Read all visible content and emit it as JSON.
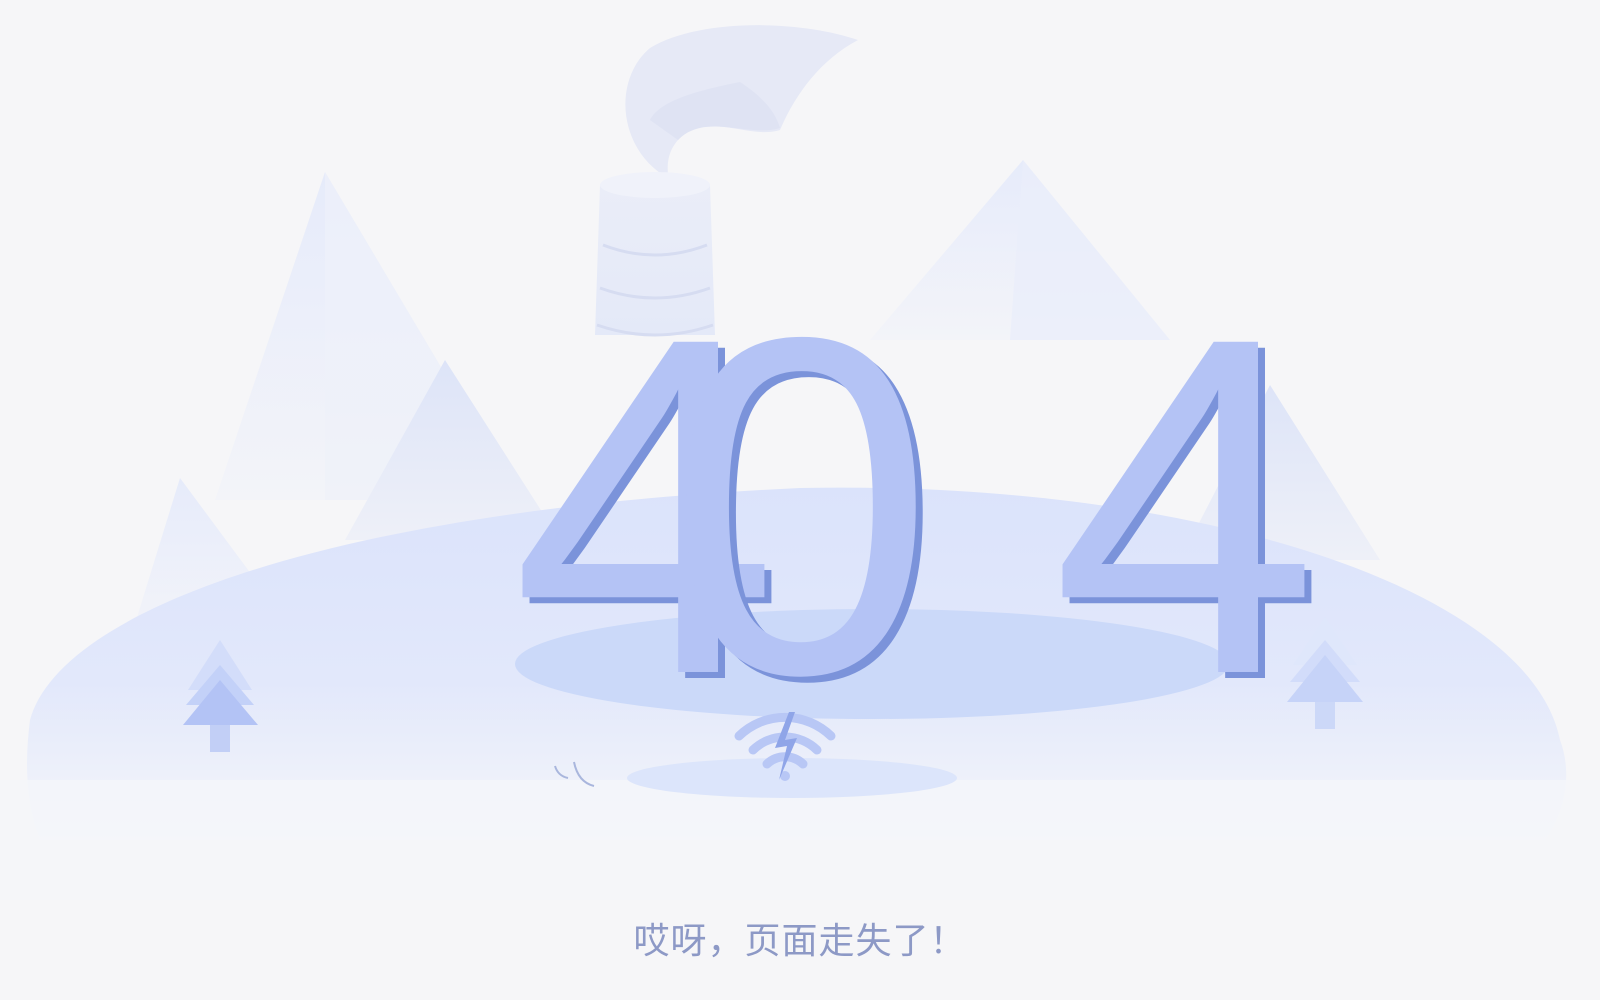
{
  "error": {
    "code": "404",
    "message": "哎呀，页面走失了！"
  },
  "illustration": {
    "elements": [
      "factory-chimney",
      "smoke",
      "mountains",
      "hill",
      "pine-trees",
      "broken-wifi-icon",
      "grass-tufts"
    ]
  },
  "colors": {
    "background": "#f6f6f8",
    "digit_face": "#b4c3f5",
    "digit_side": "#7b93da",
    "message_text": "#8d99c6",
    "hill": "#dfe6fb",
    "pool": "#c8d7fa"
  }
}
